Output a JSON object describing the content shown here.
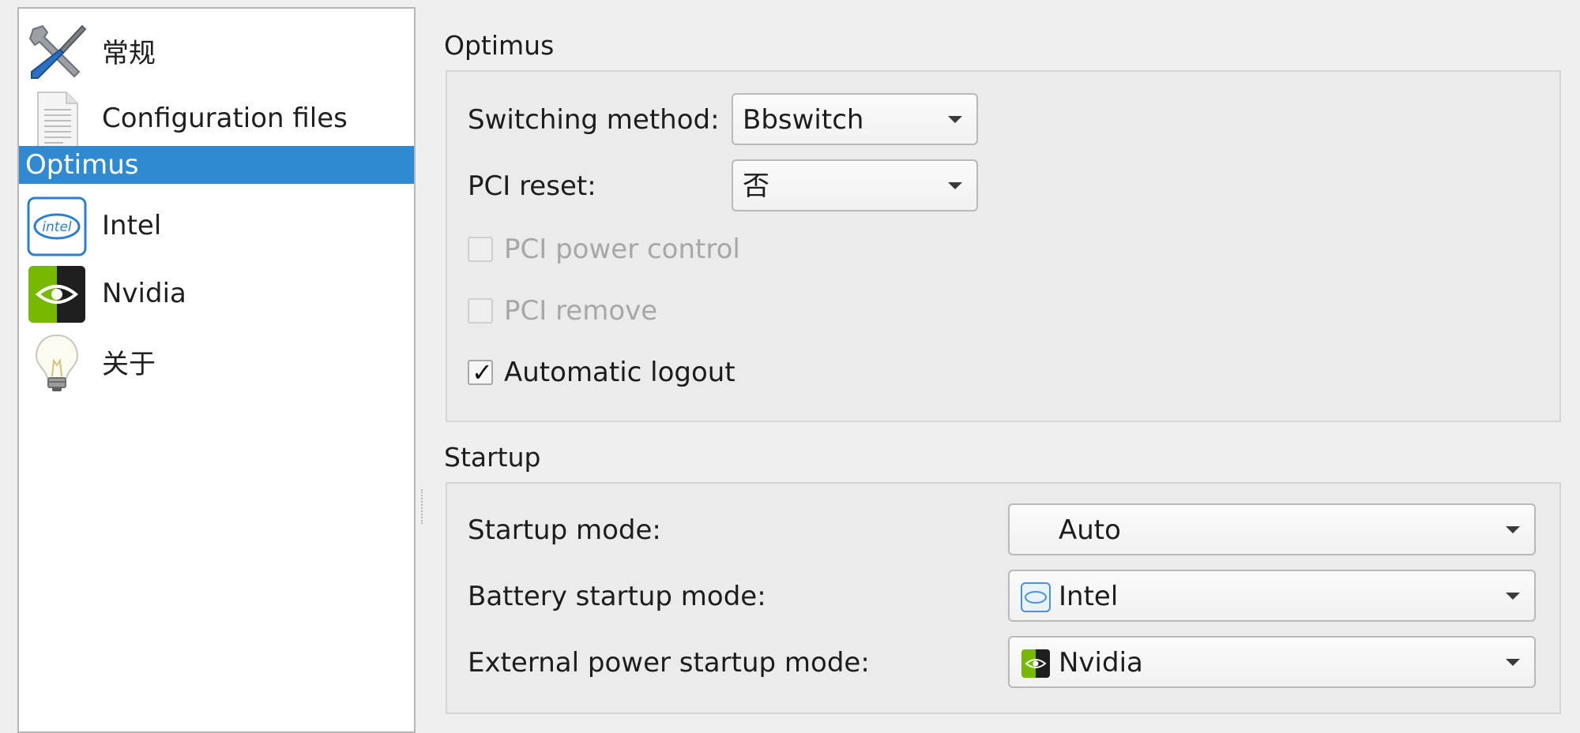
{
  "sidebar": {
    "items": [
      {
        "label": "常规",
        "icon": "tools-icon"
      },
      {
        "label": "Configuration files",
        "icon": "text-file-icon"
      },
      {
        "label": "Optimus",
        "icon": "none"
      },
      {
        "label": "Intel",
        "icon": "intel-logo-icon"
      },
      {
        "label": "Nvidia",
        "icon": "nvidia-logo-icon"
      },
      {
        "label": "关于",
        "icon": "light-bulb-icon"
      }
    ],
    "selected": "Optimus",
    "accent": "#2f8ad2"
  },
  "optimus": {
    "title": "Optimus",
    "switching_label": "Switching method:",
    "switching_value": "Bbswitch",
    "pci_reset_label": "PCI reset:",
    "pci_reset_value": "否",
    "pci_power_control": {
      "label": "PCI power control",
      "checked": false,
      "enabled": false
    },
    "pci_remove": {
      "label": "PCI remove",
      "checked": false,
      "enabled": false
    },
    "automatic_logout": {
      "label": "Automatic logout",
      "checked": true,
      "enabled": true
    }
  },
  "startup": {
    "title": "Startup",
    "startup_mode_label": "Startup mode:",
    "startup_mode_value": "Auto",
    "battery_label": "Battery startup mode:",
    "battery_value": "Intel",
    "battery_icon": "intel-logo-icon",
    "external_label": "External power startup mode:",
    "external_value": "Nvidia",
    "external_icon": "nvidia-logo-icon"
  },
  "checkmark_glyph": "✓"
}
